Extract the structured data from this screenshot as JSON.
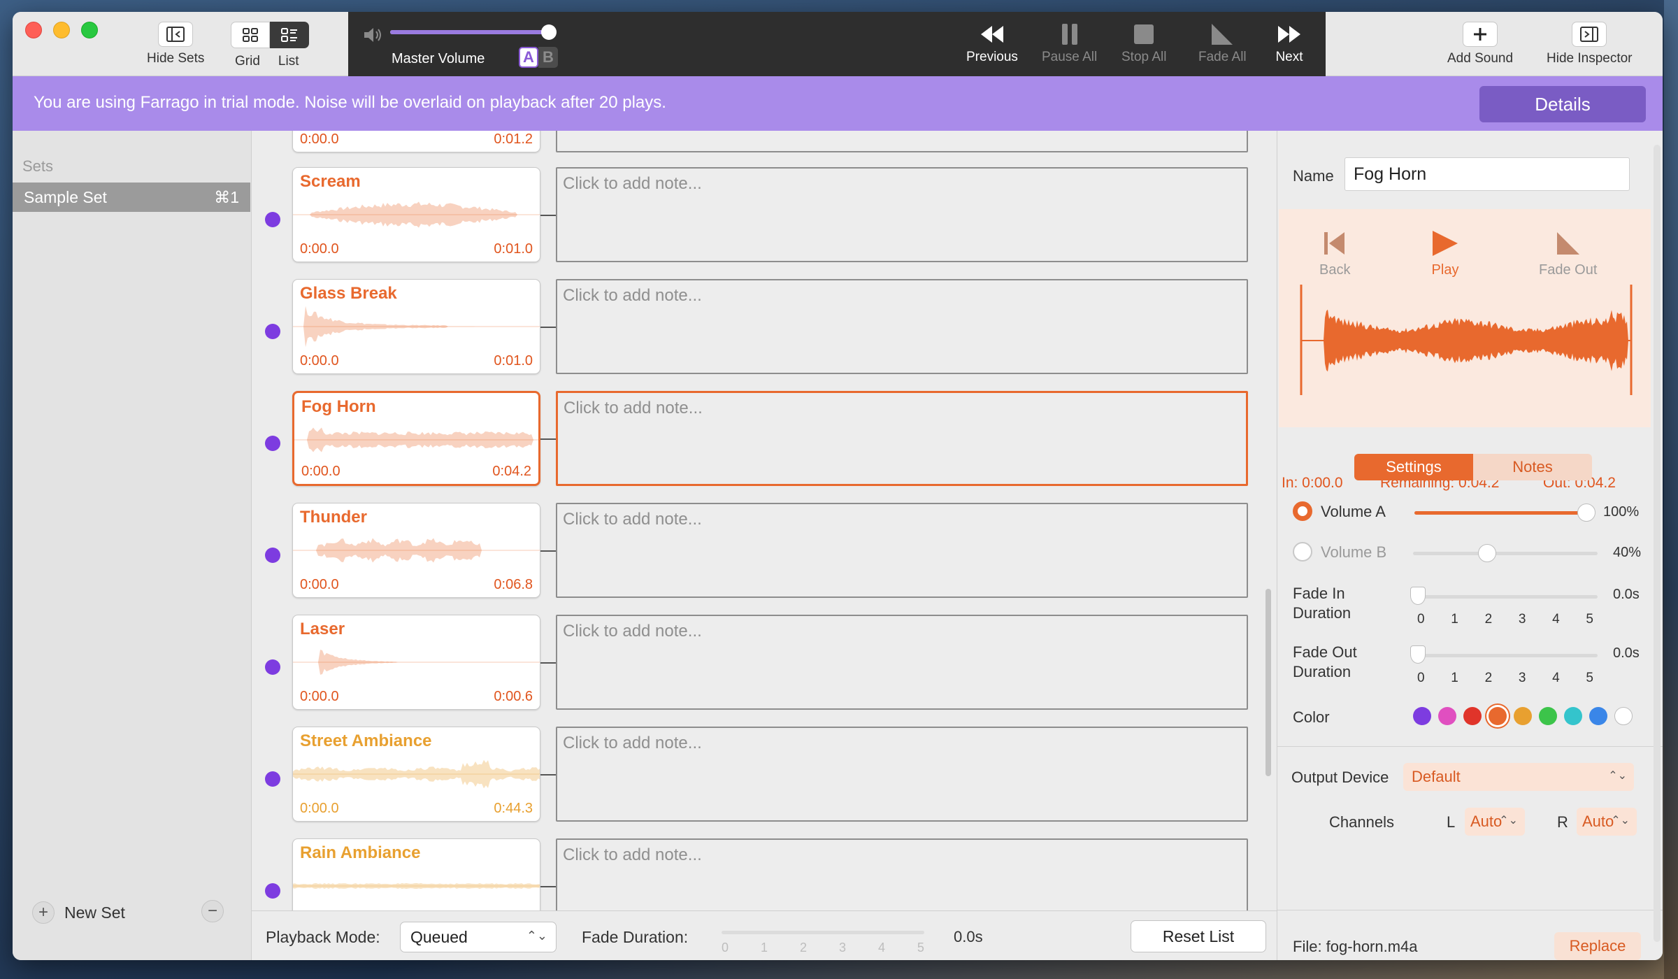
{
  "toolbar": {
    "hide_sets": "Hide Sets",
    "grid": "Grid",
    "list": "List",
    "master_volume": "Master Volume",
    "ab_a": "A",
    "ab_b": "B",
    "master_volume_level": 1.0,
    "previous": "Previous",
    "pause_all": "Pause All",
    "stop_all": "Stop All",
    "fade_all": "Fade All",
    "next": "Next",
    "add_sound": "Add Sound",
    "hide_inspector": "Hide Inspector"
  },
  "banner": {
    "text": "You are using Farrago in trial mode. Noise will be overlaid on playback after 20 plays.",
    "details": "Details"
  },
  "sidebar": {
    "heading": "Sets",
    "items": [
      {
        "label": "Sample Set",
        "shortcut": "⌘1"
      }
    ],
    "new_set": "New Set",
    "add_icon": "+",
    "remove_icon": "−"
  },
  "list": {
    "partial_top": {
      "start": "0:00.0",
      "end": "0:01.2"
    },
    "items": [
      {
        "title": "Scream",
        "start": "0:00.0",
        "end": "0:01.0",
        "note": "Click to add note...",
        "color": "#e8692e"
      },
      {
        "title": "Glass Break",
        "start": "0:00.0",
        "end": "0:01.0",
        "note": "Click to add note...",
        "color": "#e8692e"
      },
      {
        "title": "Fog Horn",
        "start": "0:00.0",
        "end": "0:04.2",
        "note": "Click to add note...",
        "color": "#e8692e",
        "selected": true
      },
      {
        "title": "Thunder",
        "start": "0:00.0",
        "end": "0:06.8",
        "note": "Click to add note...",
        "color": "#e8692e"
      },
      {
        "title": "Laser",
        "start": "0:00.0",
        "end": "0:00.6",
        "note": "Click to add note...",
        "color": "#e8692e"
      },
      {
        "title": "Street Ambiance",
        "start": "0:00.0",
        "end": "0:44.3",
        "note": "Click to add note...",
        "color": "#e8a030"
      },
      {
        "title": "Rain Ambiance",
        "start": "",
        "end": "",
        "note": "Click to add note...",
        "color": "#e8a030"
      }
    ]
  },
  "bottom": {
    "playback_mode_label": "Playback Mode:",
    "playback_mode_value": "Queued",
    "fade_duration_label": "Fade Duration:",
    "fade_ticks": [
      "0",
      "1",
      "2",
      "3",
      "4",
      "5"
    ],
    "fade_value": "0.0s",
    "reset_list": "Reset List"
  },
  "inspector": {
    "name_label": "Name",
    "name_value": "Fog Horn",
    "back": "Back",
    "play": "Play",
    "fade_out": "Fade Out",
    "in_point": "In: 0:00.0",
    "remaining": "Remaining: 0:04.2",
    "out_point": "Out: 0:04.2",
    "tab_settings": "Settings",
    "tab_notes": "Notes",
    "volume_a_label": "Volume A",
    "volume_a_value": "100%",
    "volume_a_level": 1.0,
    "volume_b_label": "Volume B",
    "volume_b_value": "40%",
    "volume_b_level": 0.4,
    "fade_in_label_1": "Fade In",
    "fade_in_label_2": "Duration",
    "fade_in_value": "0.0s",
    "fade_out_label_1": "Fade Out",
    "fade_out_label_2": "Duration",
    "fade_out_value": "0.0s",
    "ticks": [
      "0",
      "1",
      "2",
      "3",
      "4",
      "5"
    ],
    "color_label": "Color",
    "colors": [
      "#7d3ce0",
      "#e04fc0",
      "#e0342a",
      "#e8692e",
      "#e8a030",
      "#3cc44a",
      "#34c4cc",
      "#3a86e8",
      "#ffffff"
    ],
    "selected_color": "#e8692e",
    "output_device_label": "Output Device",
    "output_device_value": "Default",
    "channels_label": "Channels",
    "channel_l_label": "L",
    "channel_l_value": "Auto",
    "channel_r_label": "R",
    "channel_r_value": "Auto",
    "file_label": "File: fog-horn.m4a",
    "replace": "Replace"
  }
}
